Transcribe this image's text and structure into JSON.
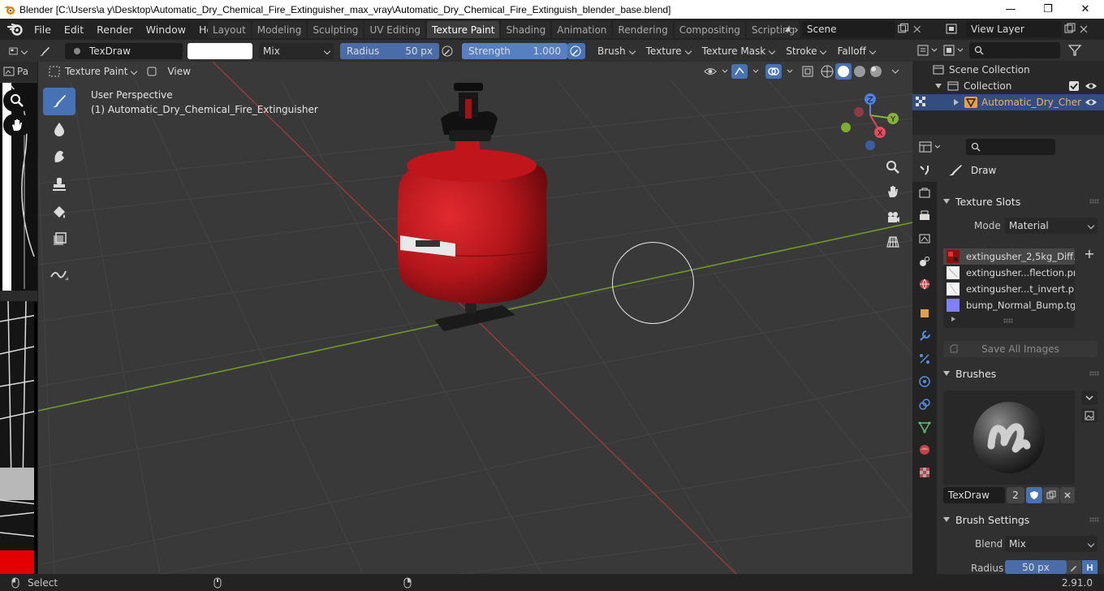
{
  "window": {
    "title": "Blender [C:\\Users\\a y\\Desktop\\Automatic_Dry_Chemical_Fire_Extinguisher_max_vray\\Automatic_Dry_Chemical_Fire_Extinguish_blender_base.blend]",
    "min": "—",
    "max": "❐",
    "close": "✕"
  },
  "menu": [
    "File",
    "Edit",
    "Render",
    "Window",
    "Help"
  ],
  "workspaces": [
    "Layout",
    "Modeling",
    "Sculpting",
    "UV Editing",
    "Texture Paint",
    "Shading",
    "Animation",
    "Rendering",
    "Compositing",
    "Scripting"
  ],
  "active_workspace": "Texture Paint",
  "scene": {
    "label": "Scene"
  },
  "view_layer": {
    "label": "View Layer"
  },
  "toolhdr": {
    "brush_name": "TexDraw",
    "blend": "Mix",
    "radius_label": "Radius",
    "radius_value": "50 px",
    "strength_label": "Strength",
    "strength_value": "1.000",
    "brush": "Brush",
    "texture": "Texture",
    "texture_mask": "Texture Mask",
    "stroke": "Stroke",
    "falloff": "Falloff",
    "color_hex": "#ffffff"
  },
  "vphdr": {
    "mode": "Texture Paint",
    "view": "View"
  },
  "viewport": {
    "perspective": "User Perspective",
    "object": "(1) Automatic_Dry_Chemical_Fire_Extinguisher",
    "axis_z": "Z",
    "axis_y": "Y",
    "axis_x": "X"
  },
  "outliner": {
    "scene_collection": "Scene Collection",
    "collection": "Collection",
    "object": "Automatic_Dry_Cher"
  },
  "properties": {
    "tool": "Draw",
    "texture_slots": "Texture Slots",
    "mode_label": "Mode",
    "mode_value": "Material",
    "slots": [
      "extingusher_2,5kg_Diff...",
      "extingusher...flection.png",
      "extingusher...t_invert.png",
      "bump_Normal_Bump.tga"
    ],
    "save_all": "Save All Images",
    "brushes": "Brushes",
    "brush_name": "TexDraw",
    "brush_users": "2",
    "brush_settings": "Brush Settings",
    "blend_label": "Blend",
    "blend_value": "Mix",
    "radius_label": "Radius",
    "radius_value": "50 px"
  },
  "status": {
    "select": "Select",
    "version": "2.91.0"
  },
  "colors": {
    "accent": "#4772b3",
    "selected_row": "#334d80",
    "extinguisher_red": "#b3161b"
  }
}
